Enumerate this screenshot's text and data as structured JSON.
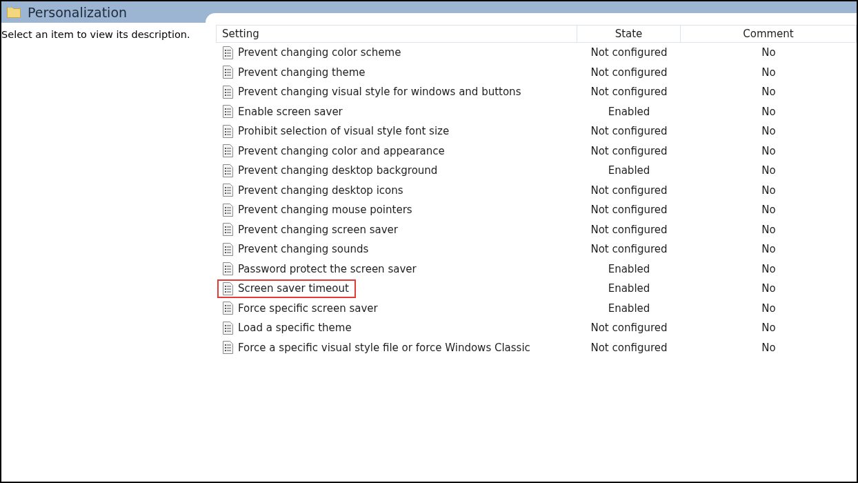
{
  "header": {
    "title": "Personalization"
  },
  "description": "Select an item to view its description.",
  "table": {
    "columns": [
      "Setting",
      "State",
      "Comment"
    ],
    "rows": [
      {
        "setting": "Prevent changing color scheme",
        "state": "Not configured",
        "comment": "No",
        "highlighted": false
      },
      {
        "setting": "Prevent changing theme",
        "state": "Not configured",
        "comment": "No",
        "highlighted": false
      },
      {
        "setting": "Prevent changing visual style for windows and buttons",
        "state": "Not configured",
        "comment": "No",
        "highlighted": false
      },
      {
        "setting": "Enable screen saver",
        "state": "Enabled",
        "comment": "No",
        "highlighted": false
      },
      {
        "setting": "Prohibit selection of visual style font size",
        "state": "Not configured",
        "comment": "No",
        "highlighted": false
      },
      {
        "setting": "Prevent changing color and appearance",
        "state": "Not configured",
        "comment": "No",
        "highlighted": false
      },
      {
        "setting": "Prevent changing desktop background",
        "state": "Enabled",
        "comment": "No",
        "highlighted": false
      },
      {
        "setting": "Prevent changing desktop icons",
        "state": "Not configured",
        "comment": "No",
        "highlighted": false
      },
      {
        "setting": "Prevent changing mouse pointers",
        "state": "Not configured",
        "comment": "No",
        "highlighted": false
      },
      {
        "setting": "Prevent changing screen saver",
        "state": "Not configured",
        "comment": "No",
        "highlighted": false
      },
      {
        "setting": "Prevent changing sounds",
        "state": "Not configured",
        "comment": "No",
        "highlighted": false
      },
      {
        "setting": "Password protect the screen saver",
        "state": "Enabled",
        "comment": "No",
        "highlighted": false
      },
      {
        "setting": "Screen saver timeout",
        "state": "Enabled",
        "comment": "No",
        "highlighted": true
      },
      {
        "setting": "Force specific screen saver",
        "state": "Enabled",
        "comment": "No",
        "highlighted": false
      },
      {
        "setting": "Load a specific theme",
        "state": "Not configured",
        "comment": "No",
        "highlighted": false
      },
      {
        "setting": "Force a specific visual style file or force Windows Classic",
        "state": "Not configured",
        "comment": "No",
        "highlighted": false
      }
    ]
  }
}
